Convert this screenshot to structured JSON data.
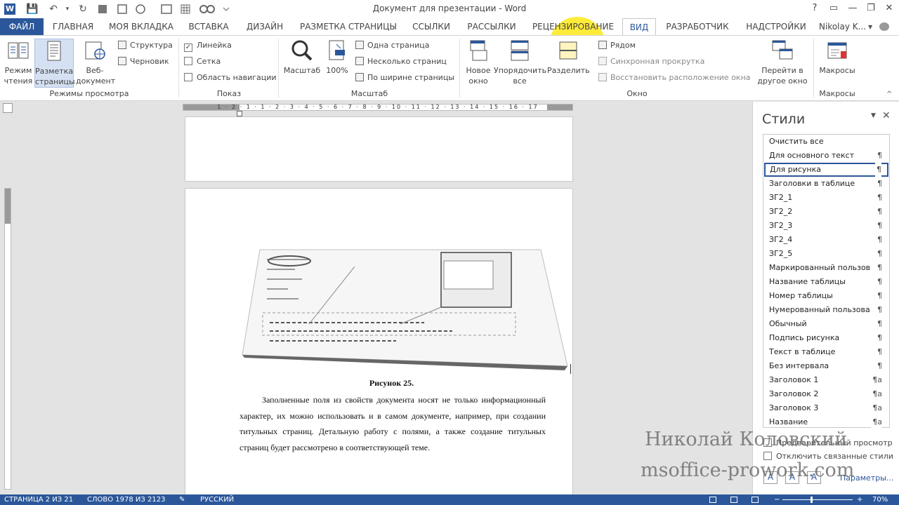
{
  "window": {
    "title": "Документ для презентации - Word",
    "controls": [
      "?",
      "▭",
      "—",
      "❐",
      "✕"
    ]
  },
  "quick_access": [
    "W",
    "💾",
    "↶",
    "▾",
    "↻"
  ],
  "tabs": [
    {
      "id": "file",
      "label": "ФАЙЛ"
    },
    {
      "id": "home",
      "label": "ГЛАВНАЯ"
    },
    {
      "id": "mytab",
      "label": "МОЯ ВКЛАДКА"
    },
    {
      "id": "insert",
      "label": "ВСТАВКА"
    },
    {
      "id": "design",
      "label": "ДИЗАЙН"
    },
    {
      "id": "layout",
      "label": "РАЗМЕТКА СТРАНИЦЫ"
    },
    {
      "id": "refs",
      "label": "ССЫЛКИ"
    },
    {
      "id": "mail",
      "label": "РАССЫЛКИ"
    },
    {
      "id": "review",
      "label": "РЕЦЕНЗИРОВАНИЕ"
    },
    {
      "id": "view",
      "label": "ВИД"
    },
    {
      "id": "dev",
      "label": "РАЗРАБОТЧИК"
    },
    {
      "id": "addins",
      "label": "НАДСТРОЙКИ"
    }
  ],
  "user": "Nikolay K...",
  "ribbon": {
    "views": {
      "label": "Режимы просмотра",
      "read_mode": "Режим чтения",
      "print_layout": "Разметка страницы",
      "web_layout": "Веб-документ",
      "outline": "Структура",
      "draft": "Черновик"
    },
    "show": {
      "label": "Показ",
      "ruler": "Линейка",
      "gridlines": "Сетка",
      "nav_pane": "Область навигации"
    },
    "zoom": {
      "label": "Масштаб",
      "zoom": "Масштаб",
      "hundred": "100%",
      "one_page": "Одна страница",
      "multi_page": "Несколько страниц",
      "page_width": "По ширине страницы"
    },
    "window": {
      "label": "Окно",
      "new_window": "Новое окно",
      "arrange_all": "Упорядочить все",
      "split": "Разделить",
      "side_by_side": "Рядом",
      "sync_scroll": "Синхронная прокрутка",
      "reset_position": "Восстановить расположение окна",
      "switch_windows": "Перейти в другое окно"
    },
    "macros": {
      "label": "Макросы",
      "macros": "Макросы"
    }
  },
  "ruler": {
    "horizontal_ticks": "1 · 2 · 1 · 1 · 2 · 3 · 4 · 5 · 6 · 7 · 8 · 9 · 10 · 11 · 12 · 13 · 14 · 15 · 16 · 17"
  },
  "document": {
    "caption": "Рисунок 25.",
    "paragraph": "Заполненные поля из свойств документа носят не только информационный характер, их можно использовать и в самом документе, например, при создании титульных страниц. Детальную работу с полями, а также создание титульных страниц будет рассмотрено в соответствующей теме."
  },
  "styles_pane": {
    "title": "Стили",
    "items": [
      {
        "label": "Очистить все",
        "mark": ""
      },
      {
        "label": "Для основного текст",
        "mark": "¶"
      },
      {
        "label": "Для рисунка",
        "mark": "¶"
      },
      {
        "label": "Заголовки в таблице",
        "mark": "¶"
      },
      {
        "label": "ЗГ2_1",
        "mark": "¶"
      },
      {
        "label": "ЗГ2_2",
        "mark": "¶"
      },
      {
        "label": "ЗГ2_3",
        "mark": "¶"
      },
      {
        "label": "ЗГ2_4",
        "mark": "¶"
      },
      {
        "label": "ЗГ2_5",
        "mark": "¶"
      },
      {
        "label": "Маркированный пользов",
        "mark": "¶"
      },
      {
        "label": "Название таблицы",
        "mark": "¶"
      },
      {
        "label": "Номер таблицы",
        "mark": "¶"
      },
      {
        "label": "Нумерованный пользова",
        "mark": "¶"
      },
      {
        "label": "Обычный",
        "mark": "¶"
      },
      {
        "label": "Подпись рисунка",
        "mark": "¶"
      },
      {
        "label": "Текст в таблице",
        "mark": "¶"
      },
      {
        "label": "Без интервала",
        "mark": "¶"
      },
      {
        "label": "Заголовок 1",
        "mark": "¶a"
      },
      {
        "label": "Заголовок 2",
        "mark": "¶a"
      },
      {
        "label": "Заголовок 3",
        "mark": "¶a"
      },
      {
        "label": "Название",
        "mark": "¶a"
      }
    ],
    "preview": "Предварительный просмотр",
    "disable_linked": "Отключить связанные стили",
    "options": "Параметры..."
  },
  "statusbar": {
    "page": "СТРАНИЦА 2 ИЗ 21",
    "words": "СЛОВО 1978 ИЗ 2123",
    "language": "РУССКИЙ",
    "zoom": "70%"
  },
  "watermark": {
    "line1": "Николай Коловский",
    "line2": "msoffice-prowork.com"
  },
  "colors": {
    "accent": "#2b579a",
    "highlight": "#ffe928"
  }
}
